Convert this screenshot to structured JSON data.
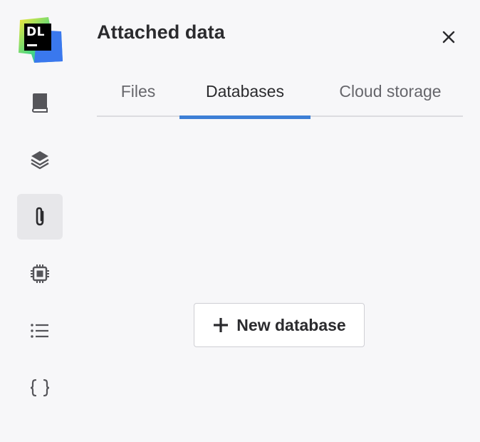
{
  "app": {
    "logo_text": "DL"
  },
  "sidebar": {
    "items": [
      {
        "icon": "book-icon",
        "active": false
      },
      {
        "icon": "layers-icon",
        "active": false
      },
      {
        "icon": "paperclip-icon",
        "active": true
      },
      {
        "icon": "chip-icon",
        "active": false
      },
      {
        "icon": "list-icon",
        "active": false
      },
      {
        "icon": "braces-icon",
        "active": false
      }
    ]
  },
  "panel": {
    "title": "Attached data",
    "close_icon": "close-icon",
    "tabs": [
      {
        "label": "Files",
        "active": false
      },
      {
        "label": "Databases",
        "active": true
      },
      {
        "label": "Cloud storage",
        "active": false
      }
    ],
    "new_database_label": "New database",
    "new_database_icon": "plus-icon"
  },
  "colors": {
    "background": "#f7f7f9",
    "accent": "#3d7fd6",
    "text_primary": "#2b2b2e",
    "text_secondary": "#66666b",
    "active_sidebar_bg": "#e7e7ea"
  }
}
